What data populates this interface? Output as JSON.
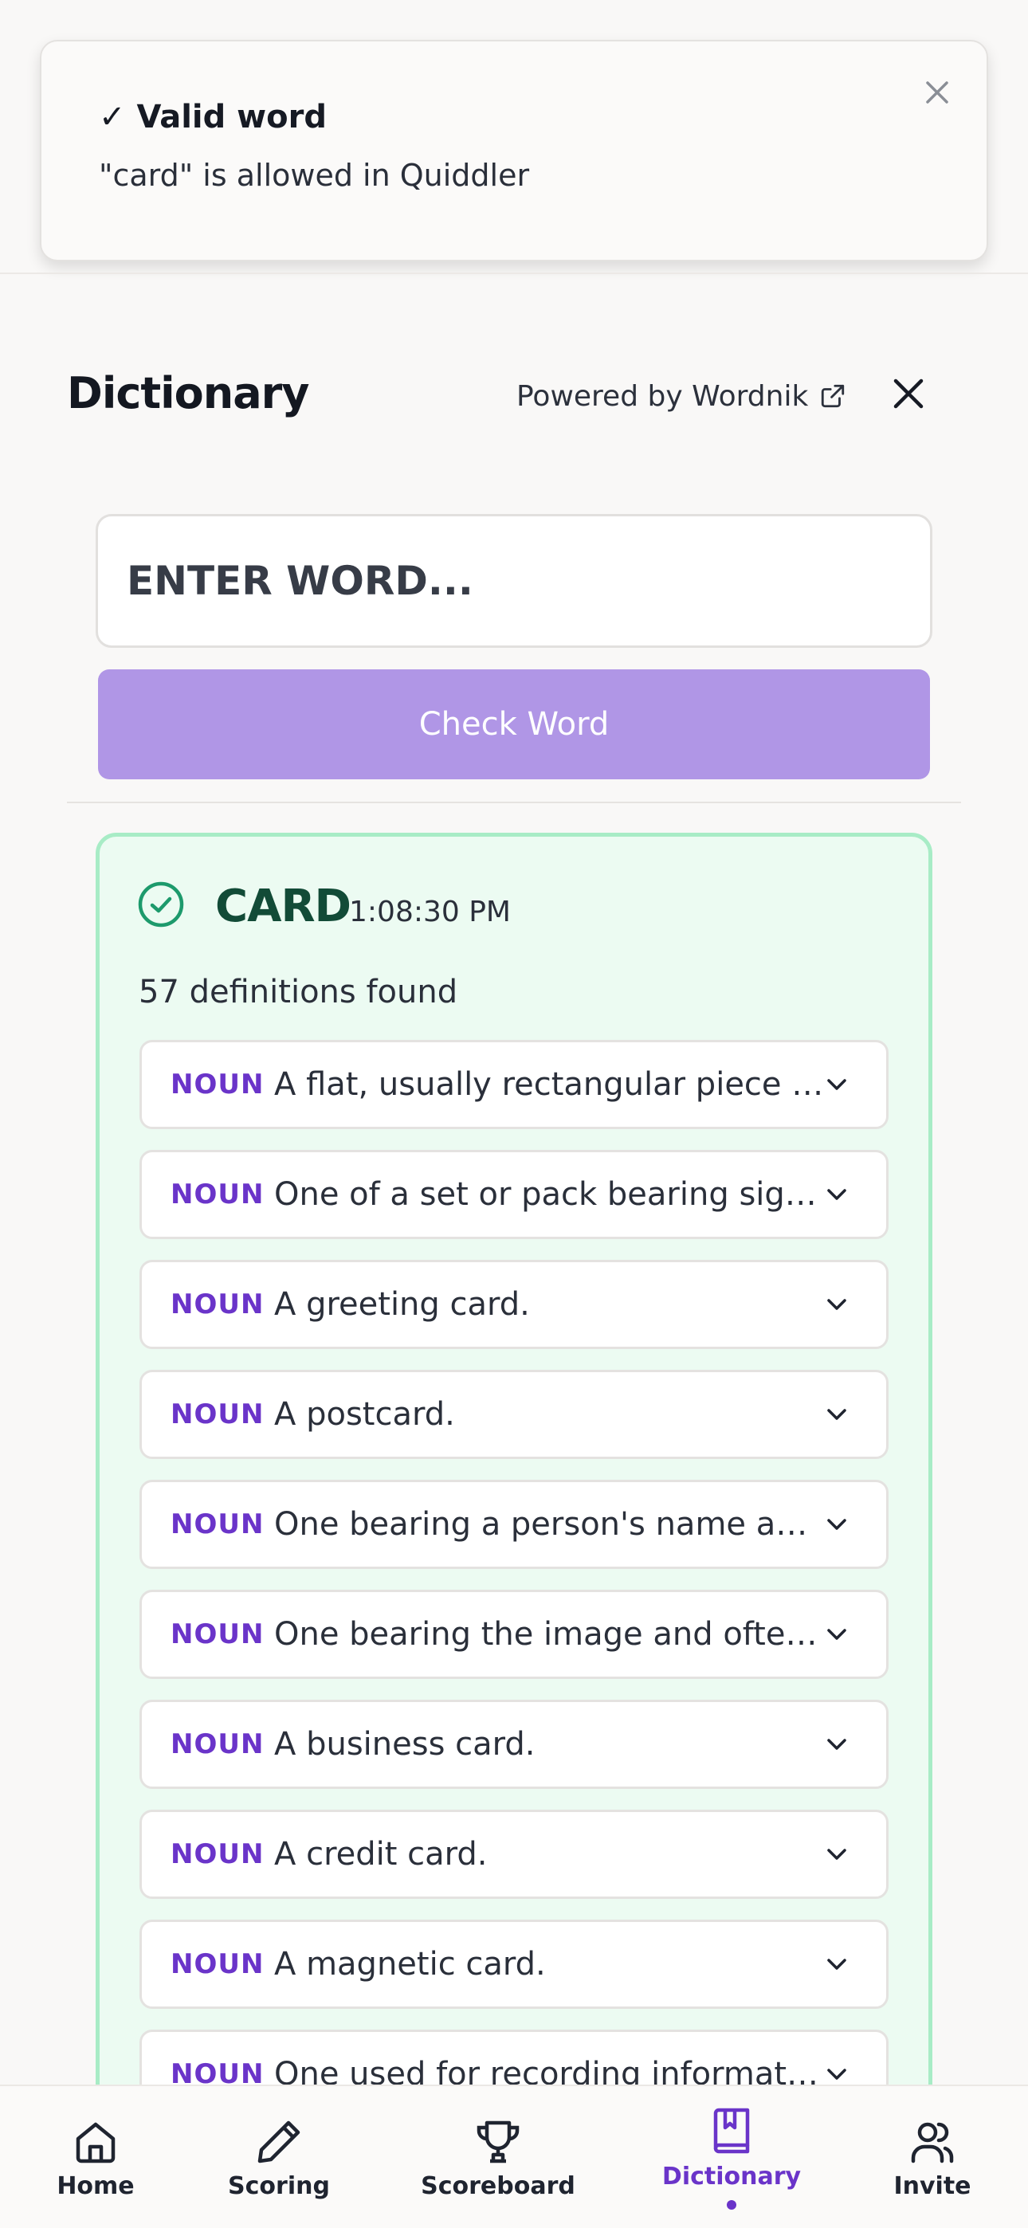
{
  "toast": {
    "title": "✓ Valid word",
    "message": "\"card\" is allowed in Quiddler"
  },
  "header": {
    "title": "Dictionary",
    "powered_by": "Powered by Wordnik"
  },
  "search": {
    "placeholder": "ENTER WORD...",
    "button_label": "Check Word"
  },
  "result": {
    "word": "CARD",
    "time": "1:08:30 PM",
    "count_text": "57 definitions found",
    "definitions": [
      {
        "pos": "NOUN",
        "text": "A flat, usually rectangular piece of stiff paper"
      },
      {
        "pos": "NOUN",
        "text": "One of a set or pack bearing significant numbers"
      },
      {
        "pos": "NOUN",
        "text": "A greeting card."
      },
      {
        "pos": "NOUN",
        "text": "A postcard."
      },
      {
        "pos": "NOUN",
        "text": "One bearing a person's name and address"
      },
      {
        "pos": "NOUN",
        "text": "One bearing the image and often statistics"
      },
      {
        "pos": "NOUN",
        "text": "A business card."
      },
      {
        "pos": "NOUN",
        "text": "A credit card."
      },
      {
        "pos": "NOUN",
        "text": "A magnetic card."
      },
      {
        "pos": "NOUN",
        "text": "One used for recording information"
      }
    ]
  },
  "nav": {
    "items": [
      {
        "label": "Home"
      },
      {
        "label": "Scoring"
      },
      {
        "label": "Scoreboard"
      },
      {
        "label": "Dictionary"
      },
      {
        "label": "Invite"
      }
    ],
    "active_index": 3
  },
  "colors": {
    "accent": "#6a34c9",
    "button": "#b096e6",
    "success_border": "#a8ecc6",
    "success_bg": "#ecfbf2",
    "success_text": "#124b37"
  }
}
